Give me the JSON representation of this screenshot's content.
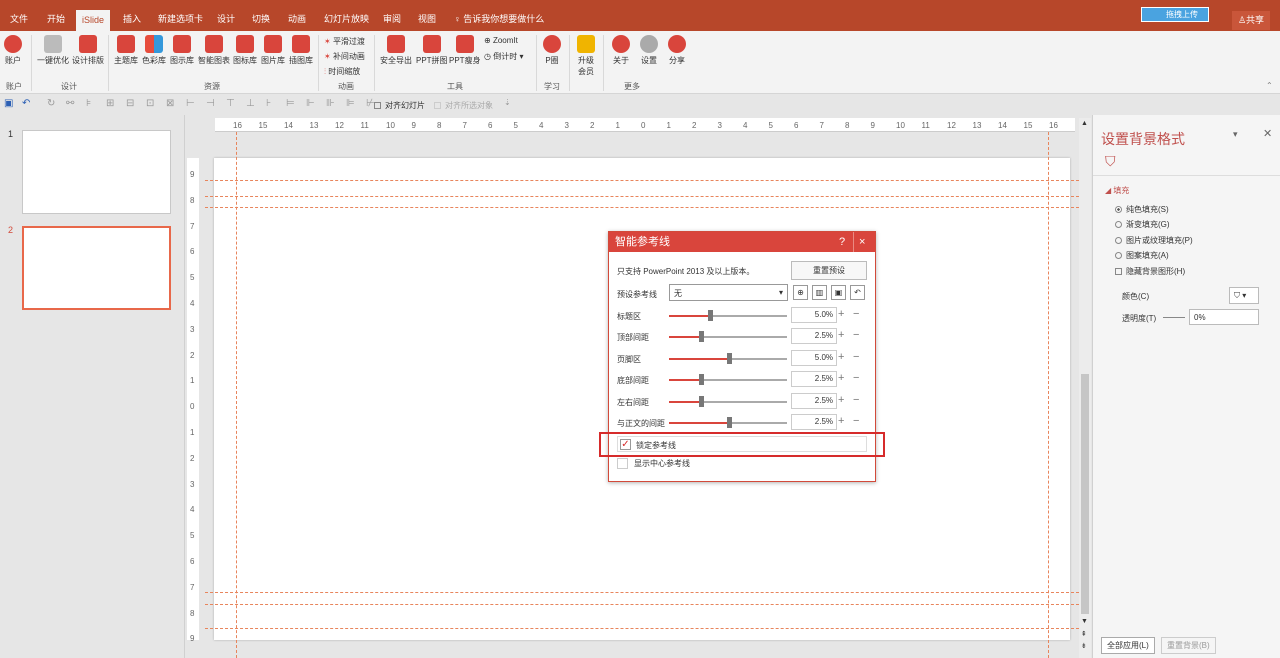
{
  "colors": {
    "accent": "#b7472a",
    "dialog": "#d9453c",
    "guide": "#e8855c",
    "highlight": "#d62b2b"
  },
  "tabs": [
    {
      "label": "文件"
    },
    {
      "label": "开始"
    },
    {
      "label": "iSlide"
    },
    {
      "label": "插入"
    },
    {
      "label": "新建选项卡"
    },
    {
      "label": "设计"
    },
    {
      "label": "切换"
    },
    {
      "label": "动画"
    },
    {
      "label": "幻灯片放映"
    },
    {
      "label": "审阅"
    },
    {
      "label": "视图"
    }
  ],
  "tellme": "告诉我你想要做什么",
  "upload_label": "拖拽上传",
  "share_label": "共享",
  "ribbon": {
    "account": "账户",
    "onekey": "一键优化",
    "design_layout": "设计排版",
    "theme": "主题库",
    "color": "色彩库",
    "diagram": "图示库",
    "chart": "智能图表",
    "icon": "图标库",
    "picture": "图片库",
    "illus": "插图库",
    "smooth": "平滑过渡",
    "tween": "补间动画",
    "timescale": "时间缩放",
    "export": "安全导出",
    "ppt_puzzle": "PPT拼图",
    "ppt_slim": "PPT瘦身",
    "zoomit": "ZoomIt",
    "countdown": "倒计时",
    "pcircle": "P圈",
    "upgrade": "升级",
    "member": "会员",
    "about": "关于",
    "settings": "设置",
    "shareb": "分享",
    "groups": {
      "account": "账户",
      "design": "设计",
      "resources": "资源",
      "animation": "动画",
      "tools": "工具",
      "learn": "学习",
      "more": "更多"
    }
  },
  "qat": {
    "align_slide": "对齐幻灯片",
    "align_selected": "对齐所选对象"
  },
  "slides": [
    {
      "num": "1"
    },
    {
      "num": "2"
    }
  ],
  "hruler": [
    "16",
    "15",
    "14",
    "13",
    "12",
    "11",
    "10",
    "9",
    "8",
    "7",
    "6",
    "5",
    "4",
    "3",
    "2",
    "1",
    "0",
    "1",
    "2",
    "3",
    "4",
    "5",
    "6",
    "7",
    "8",
    "9",
    "10",
    "11",
    "12",
    "13",
    "14",
    "15",
    "16"
  ],
  "vruler": [
    "9",
    "8",
    "7",
    "6",
    "5",
    "4",
    "3",
    "2",
    "1",
    "0",
    "1",
    "2",
    "3",
    "4",
    "5",
    "6",
    "7",
    "8",
    "9"
  ],
  "panel": {
    "title": "设置背景格式",
    "fill": "填充",
    "opts": [
      "纯色填充(S)",
      "渐变填充(G)",
      "图片或纹理填充(P)",
      "图案填充(A)"
    ],
    "hide": "隐藏背景图形(H)",
    "color": "颜色(C)",
    "transparency": "透明度(T)",
    "trans_val": "0%",
    "apply_all": "全部应用(L)",
    "reset": "重置背景(B)"
  },
  "dialog": {
    "title": "智能参考线",
    "help": "?",
    "close": "×",
    "note": "只支持 PowerPoint 2013 及以上版本。",
    "reset_preset": "重置预设",
    "preset_label": "预设参考线",
    "preset_value": "无",
    "rows": [
      {
        "label": "标题区",
        "value": "5.0%",
        "pos": 0.35
      },
      {
        "label": "顶部间距",
        "value": "2.5%",
        "pos": 0.27
      },
      {
        "label": "页脚区",
        "value": "5.0%",
        "pos": 0.51
      },
      {
        "label": "底部间距",
        "value": "2.5%",
        "pos": 0.27
      },
      {
        "label": "左右间距",
        "value": "2.5%",
        "pos": 0.27
      },
      {
        "label": "与正文的间距",
        "value": "2.5%",
        "pos": 0.51
      }
    ],
    "lock": "锁定参考线",
    "center": "显示中心参考线"
  }
}
